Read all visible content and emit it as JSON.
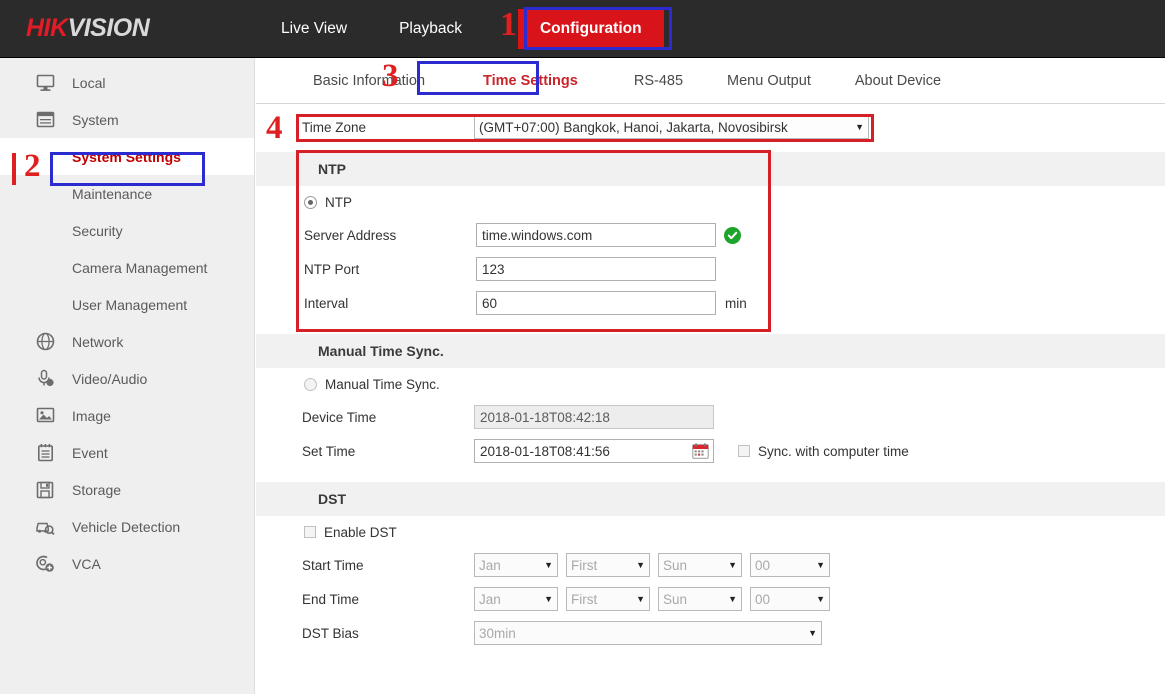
{
  "brand": {
    "part1": "HIK",
    "part2": "VISION"
  },
  "topnav": {
    "items": [
      {
        "label": "Live View",
        "active": false
      },
      {
        "label": "Playback",
        "active": false
      },
      {
        "label": "Configuration",
        "active": true
      }
    ]
  },
  "sidebar": {
    "items": [
      {
        "label": "Local",
        "icon": "monitor-icon",
        "sub": false,
        "selected": false
      },
      {
        "label": "System",
        "icon": "window-icon",
        "sub": false,
        "selected": false
      },
      {
        "label": "System Settings",
        "icon": "",
        "sub": true,
        "selected": true
      },
      {
        "label": "Maintenance",
        "icon": "",
        "sub": true,
        "selected": false
      },
      {
        "label": "Security",
        "icon": "",
        "sub": true,
        "selected": false
      },
      {
        "label": "Camera Management",
        "icon": "",
        "sub": true,
        "selected": false
      },
      {
        "label": "User Management",
        "icon": "",
        "sub": true,
        "selected": false
      },
      {
        "label": "Network",
        "icon": "globe-icon",
        "sub": false,
        "selected": false
      },
      {
        "label": "Video/Audio",
        "icon": "microphone-icon",
        "sub": false,
        "selected": false
      },
      {
        "label": "Image",
        "icon": "picture-icon",
        "sub": false,
        "selected": false
      },
      {
        "label": "Event",
        "icon": "clipboard-icon",
        "sub": false,
        "selected": false
      },
      {
        "label": "Storage",
        "icon": "floppy-disk-icon",
        "sub": false,
        "selected": false
      },
      {
        "label": "Vehicle Detection",
        "icon": "car-search-icon",
        "sub": false,
        "selected": false
      },
      {
        "label": "VCA",
        "icon": "vca-icon",
        "sub": false,
        "selected": false
      }
    ]
  },
  "tabs": [
    {
      "label": "Basic Information",
      "active": false
    },
    {
      "label": "Time Settings",
      "active": true
    },
    {
      "label": "RS-485",
      "active": false
    },
    {
      "label": "Menu Output",
      "active": false
    },
    {
      "label": "About Device",
      "active": false
    }
  ],
  "timezone": {
    "label": "Time Zone",
    "value": "(GMT+07:00) Bangkok, Hanoi, Jakarta, Novosibirsk"
  },
  "ntp": {
    "section_title": "NTP",
    "radio_label": "NTP",
    "radio_selected": true,
    "server_address": {
      "label": "Server Address",
      "value": "time.windows.com",
      "status_icon": "green-check-icon"
    },
    "port": {
      "label": "NTP Port",
      "value": "123"
    },
    "interval": {
      "label": "Interval",
      "value": "60",
      "unit": "min"
    }
  },
  "manual_sync": {
    "section_title": "Manual Time Sync.",
    "radio_label": "Manual Time Sync.",
    "radio_selected": false,
    "device_time": {
      "label": "Device Time",
      "value": "2018-01-18T08:42:18"
    },
    "set_time": {
      "label": "Set Time",
      "value": "2018-01-18T08:41:56",
      "icon": "calendar-icon"
    },
    "sync_checkbox": {
      "label": "Sync. with computer time",
      "checked": false
    }
  },
  "dst": {
    "section_title": "DST",
    "enable": {
      "label": "Enable DST",
      "checked": false
    },
    "start_time": {
      "label": "Start Time",
      "month": "Jan",
      "week": "First",
      "day": "Sun",
      "hour": "00"
    },
    "end_time": {
      "label": "End Time",
      "month": "Jan",
      "week": "First",
      "day": "Sun",
      "hour": "00"
    },
    "bias": {
      "label": "DST Bias",
      "value": "30min"
    }
  },
  "annotations": {
    "n1": "1",
    "n2": "2",
    "n3": "3",
    "n4": "4"
  },
  "colors": {
    "brand_red": "#e01c26",
    "active_tab_bg": "#d8131a",
    "anno_red": "#d42026",
    "anno_blue": "#2b2bd0",
    "header_dark": "#2b2b2b",
    "sidebar_bg": "#efefef",
    "success_green": "#1fa42b"
  }
}
